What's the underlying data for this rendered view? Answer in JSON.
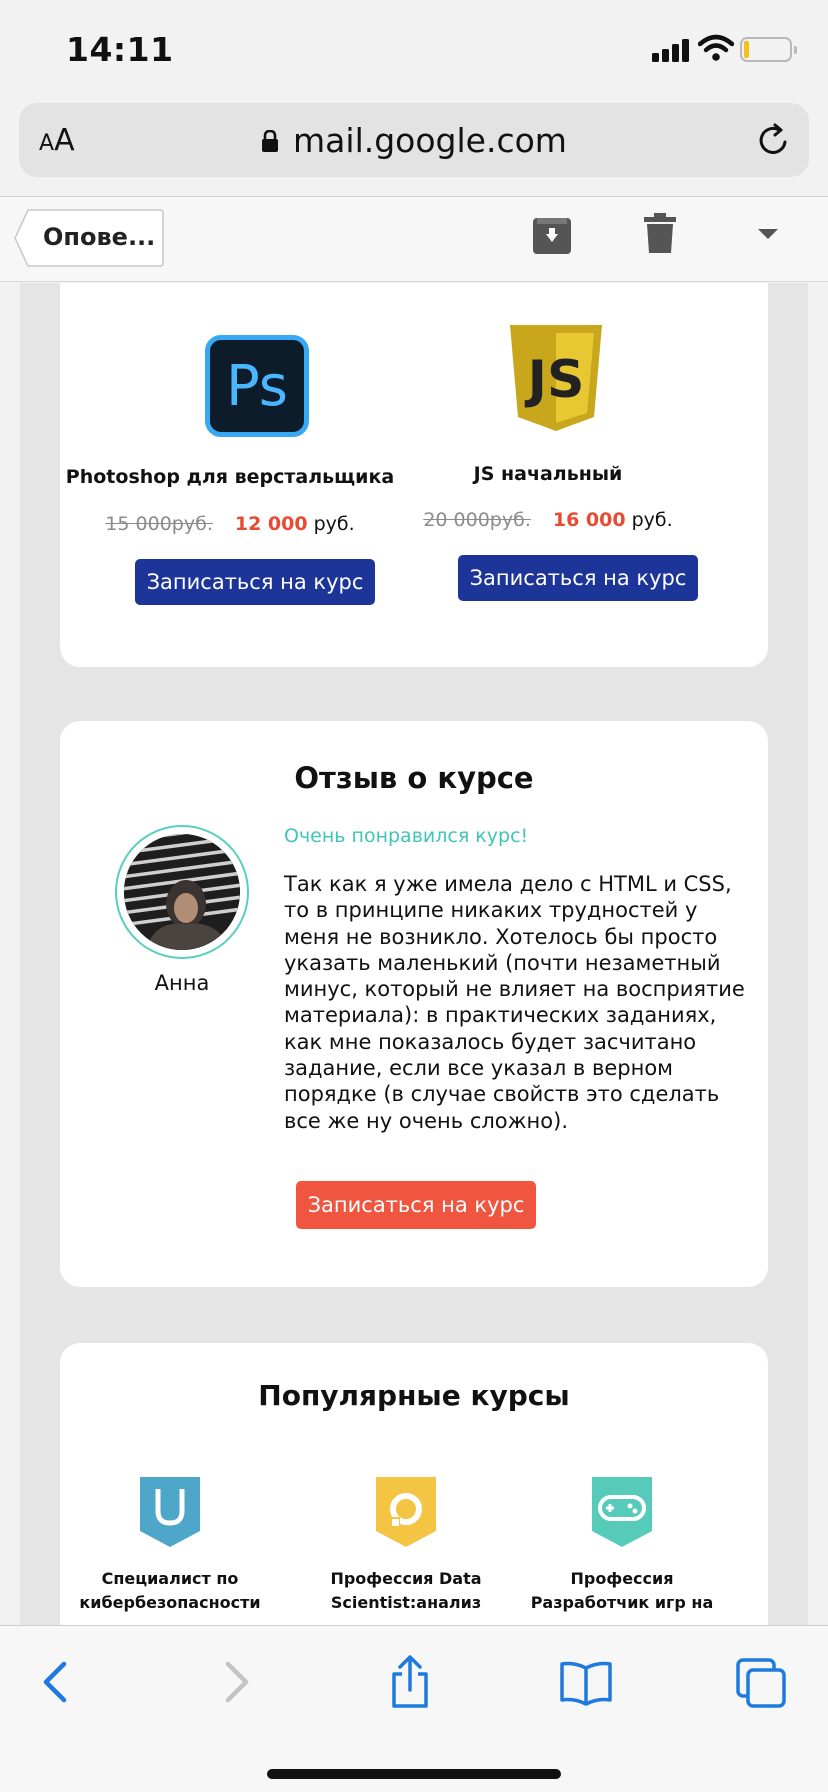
{
  "status": {
    "time": "14:11",
    "icons": [
      "signal-icon",
      "wifi-icon",
      "battery-icon"
    ],
    "battery_level": 0.1
  },
  "browser": {
    "text_size_label": "AA",
    "url": "mail.google.com",
    "icons": [
      "lock-icon",
      "reload-icon"
    ]
  },
  "mail_toolbar": {
    "back_label": "Опове...",
    "icons": [
      "archive-icon",
      "trash-icon",
      "more-dropdown-icon"
    ]
  },
  "courses": [
    {
      "logo": "photoshop-logo",
      "logo_text": "Ps",
      "title": "Photoshop для верстальщика",
      "old_price": "15 000руб.",
      "new_price": "12 000",
      "currency": "руб.",
      "button": "Записаться на курс"
    },
    {
      "logo": "javascript-logo",
      "logo_text": "JS",
      "title": "JS начальный",
      "old_price": "20 000руб.",
      "new_price": "16 000",
      "currency": "руб.",
      "button": "Записаться на курс"
    }
  ],
  "review": {
    "heading": "Отзыв о курсе",
    "author": "Анна",
    "subtitle": "Очень понравился курс!",
    "text": "Так как я уже имела дело с HTML и CSS, то в принципе никаких трудностей у меня не возникло. Хотелось бы просто указать маленький (почти незаметный минус, который не влияет на восприятие материала): в практических заданиях, как мне показалось будет засчитано задание, если все указал в верном порядке (в случае свойств это сделать все же ну очень сложно).",
    "button": "Записаться на курс"
  },
  "popular": {
    "heading": "Популярные курсы",
    "items": [
      {
        "icon": "shield-icon",
        "name": "Специалист по кибербезопасности"
      },
      {
        "icon": "data-science-icon",
        "name": "Профессия Data Scientist:анализ"
      },
      {
        "icon": "gamepad-icon",
        "name": "Профессия Разработчик игр на"
      }
    ]
  },
  "colors": {
    "accent_blue": "#1d3599",
    "accent_red": "#ef553f",
    "accent_teal": "#3fc6b7",
    "price_red": "#e74b33",
    "ios_blue": "#1f7ae0"
  },
  "bottom_toolbar": {
    "icons": [
      "back-arrow-icon",
      "forward-arrow-icon",
      "share-icon",
      "bookmarks-icon",
      "tabs-icon"
    ]
  }
}
